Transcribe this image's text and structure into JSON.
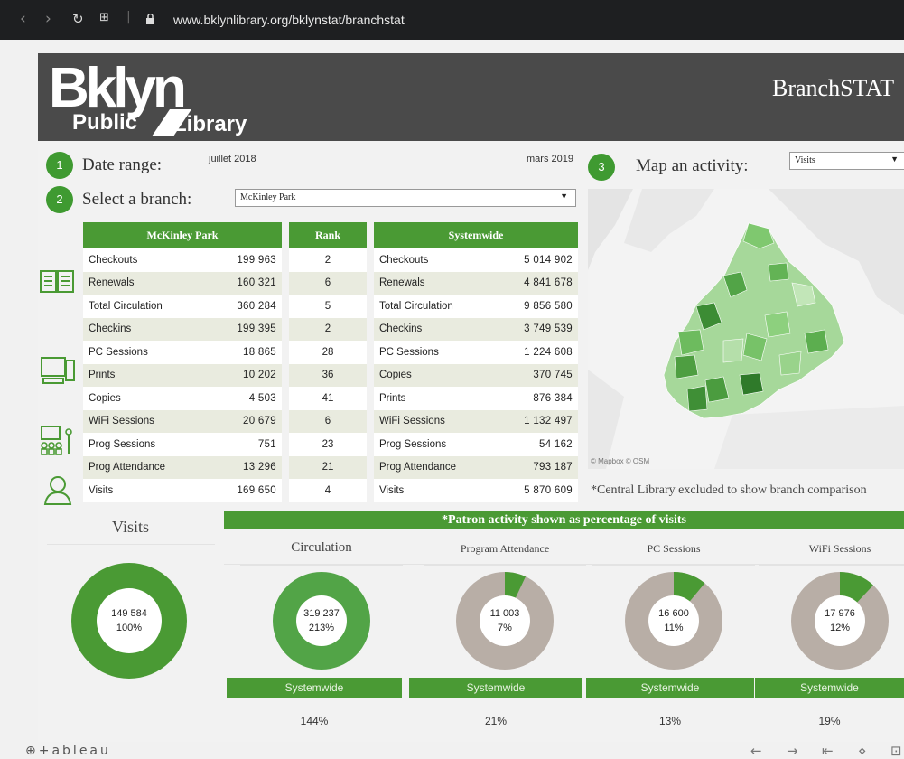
{
  "browser": {
    "url": "www.bklynlibrary.org/bklynstat/branchstat"
  },
  "header": {
    "logo_top": "Bklyn",
    "logo_public": "Public",
    "logo_library": "Library",
    "title": "BranchSTAT"
  },
  "controls": {
    "step1": "1",
    "date_label": "Date range:",
    "date_start": "juillet 2018",
    "date_end": "mars 2019",
    "step2": "2",
    "branch_label": "Select a branch:",
    "branch_value": "McKinley Park",
    "step3": "3",
    "activity_label": "Map an activity:",
    "activity_value": "Visits"
  },
  "branch_table": {
    "header": "McKinley Park",
    "rank_header": "Rank",
    "rows": [
      {
        "label": "Checkouts",
        "value": "199 963",
        "rank": "2"
      },
      {
        "label": "Renewals",
        "value": "160 321",
        "rank": "6"
      },
      {
        "label": "Total Circulation",
        "value": "360 284",
        "rank": "5"
      },
      {
        "label": "Checkins",
        "value": "199 395",
        "rank": "2"
      },
      {
        "label": "PC Sessions",
        "value": "18 865",
        "rank": "28"
      },
      {
        "label": "Prints",
        "value": "10 202",
        "rank": "36"
      },
      {
        "label": "Copies",
        "value": "4 503",
        "rank": "41"
      },
      {
        "label": "WiFi Sessions",
        "value": "20 679",
        "rank": "6"
      },
      {
        "label": "Prog Sessions",
        "value": "751",
        "rank": "23"
      },
      {
        "label": "Prog Attendance",
        "value": "13 296",
        "rank": "21"
      },
      {
        "label": "Visits",
        "value": "169 650",
        "rank": "4"
      }
    ]
  },
  "system_table": {
    "header": "Systemwide",
    "rows": [
      {
        "label": "Checkouts",
        "value": "5 014 902"
      },
      {
        "label": "Renewals",
        "value": "4 841 678"
      },
      {
        "label": "Total Circulation",
        "value": "9 856 580"
      },
      {
        "label": "Checkins",
        "value": "3 749 539"
      },
      {
        "label": "PC Sessions",
        "value": "1 224 608"
      },
      {
        "label": "Copies",
        "value": "370 745"
      },
      {
        "label": "Prints",
        "value": "876 384"
      },
      {
        "label": "WiFi Sessions",
        "value": "1 132 497"
      },
      {
        "label": "Prog Sessions",
        "value": "54 162"
      },
      {
        "label": "Prog Attendance",
        "value": "793 187"
      },
      {
        "label": "Visits",
        "value": "5 870 609"
      }
    ]
  },
  "map": {
    "attribution": "© Mapbox © OSM",
    "note": "*Central Library excluded to show branch comparison"
  },
  "patron": {
    "banner": "*Patron activity shown as percentage of visits",
    "visits": {
      "title": "Visits",
      "value": "149 584",
      "pct": "100%",
      "fraction": 1.0
    },
    "donuts": [
      {
        "title": "Circulation",
        "value": "319 237",
        "pct": "213%",
        "fraction": 1.0,
        "systemwide": "Systemwide",
        "system_pct": "144%"
      },
      {
        "title": "Program Attendance",
        "value": "11 003",
        "pct": "7%",
        "fraction": 0.07,
        "systemwide": "Systemwide",
        "system_pct": "21%"
      },
      {
        "title": "PC Sessions",
        "value": "16 600",
        "pct": "11%",
        "fraction": 0.11,
        "systemwide": "Systemwide",
        "system_pct": "13%"
      },
      {
        "title": "WiFi Sessions",
        "value": "17 976",
        "pct": "12%",
        "fraction": 0.12,
        "systemwide": "Systemwide",
        "system_pct": "19%"
      }
    ]
  },
  "footer": {
    "brand": "+ableau"
  },
  "colors": {
    "green": "#4a9a34",
    "dark_green": "#3f9a31",
    "gray": "#b8aea6",
    "banner": "#4a4a4a"
  }
}
